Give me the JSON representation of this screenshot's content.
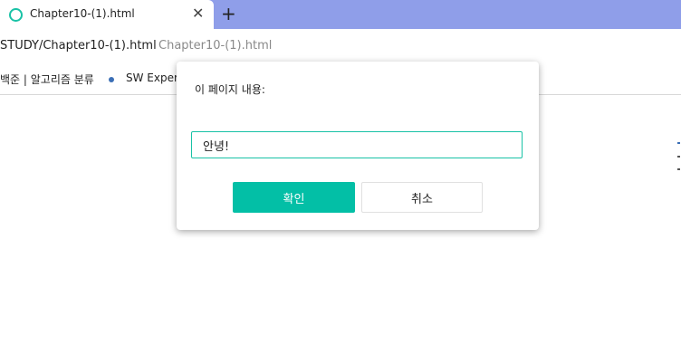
{
  "tab": {
    "title": "Chapter10-(1).html",
    "close_glyph": "✕",
    "favicon_icon": "loading-circle-icon"
  },
  "new_tab_glyph": "+",
  "address": {
    "path": "STUDY/Chapter10-(1).html",
    "page_title": "Chapter10-(1).html"
  },
  "bookmarks": [
    {
      "label": "백준 | 알고리즘 분류"
    },
    {
      "label": "SW Expert"
    }
  ],
  "dialog": {
    "message": "이 페이지 내용:",
    "input_value": "안녕!",
    "ok_label": "확인",
    "cancel_label": "취소"
  },
  "colors": {
    "tab_strip": "#8f9ee9",
    "accent": "#03bfa6",
    "bookmark_dot": "#3b6fb6"
  }
}
